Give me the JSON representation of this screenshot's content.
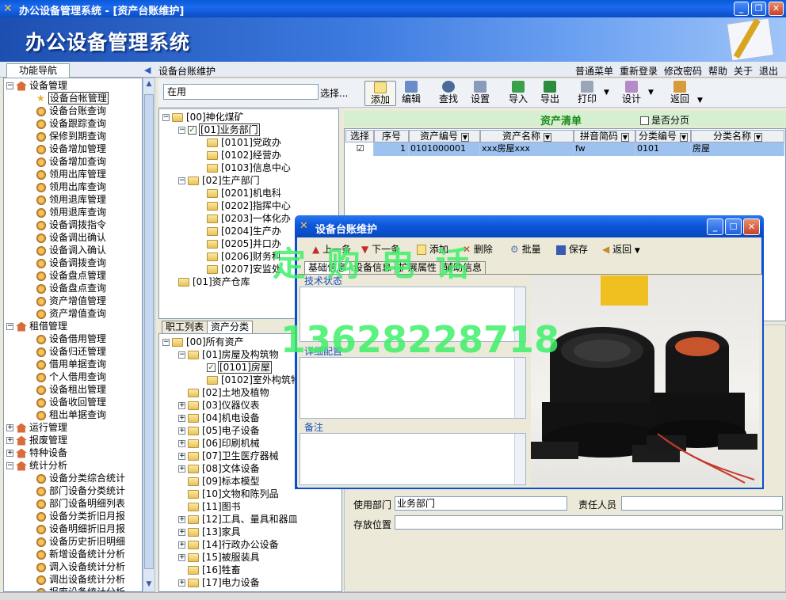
{
  "window": {
    "title": "办公设备管理系统 - [资产台账维护]"
  },
  "banner": {
    "title": "办公设备管理系统"
  },
  "nav": {
    "tab_label": "功能导航",
    "breadcrumb": "设备台账维护",
    "top_menu": [
      "普通菜单",
      "重新登录",
      "修改密码",
      "帮助",
      "关于",
      "退出"
    ]
  },
  "sidebar": {
    "groups": [
      {
        "label": "设备管理",
        "expanded": true,
        "items": [
          "设备台帐管理",
          "设备台账查询",
          "设备跟踪查询",
          "保修到期查询",
          "设备增加管理",
          "设备增加查询",
          "领用出库管理",
          "领用出库查询",
          "领用退库管理",
          "领用退库查询",
          "设备调拨指令",
          "设备调出确认",
          "设备调入确认",
          "设备调拨查询",
          "设备盘点管理",
          "设备盘点查询",
          "资产增值管理",
          "资产增值查询"
        ]
      },
      {
        "label": "租借管理",
        "expanded": true,
        "items": [
          "设备借用管理",
          "设备归还管理",
          "借用单据查询",
          "个人借用查询",
          "设备租出管理",
          "设备收回管理",
          "租出单据查询"
        ]
      },
      {
        "label": "运行管理",
        "expanded": false,
        "items": []
      },
      {
        "label": "报废管理",
        "expanded": false,
        "items": []
      },
      {
        "label": "特种设备",
        "expanded": false,
        "items": []
      },
      {
        "label": "统计分析",
        "expanded": true,
        "items": [
          "设备分类综合统计",
          "部门设备分类统计",
          "部门设备明细列表",
          "设备分类折旧月报",
          "设备明细折旧月报",
          "设备历史折旧明细",
          "新增设备统计分析",
          "调入设备统计分析",
          "调出设备统计分析",
          "报废设备统计分析"
        ]
      }
    ],
    "selected": "设备台帐管理"
  },
  "filter": {
    "status_value": "在用",
    "select_label": "选择..."
  },
  "toolbar": {
    "add": "添加",
    "edit": "编辑",
    "find": "查找",
    "settings": "设置",
    "import": "导入",
    "export": "导出",
    "print": "打印",
    "design": "设计",
    "back": "返回"
  },
  "org_tree": {
    "root": "[00]神化煤矿",
    "nodes": [
      {
        "label": "[01]业务部门",
        "level": 1,
        "checked": true,
        "selected": true
      },
      {
        "label": "[0101]党政办",
        "level": 2
      },
      {
        "label": "[0102]经营办",
        "level": 2
      },
      {
        "label": "[0103]信息中心",
        "level": 2
      },
      {
        "label": "[02]生产部门",
        "level": 1
      },
      {
        "label": "[0201]机电科",
        "level": 2
      },
      {
        "label": "[0202]指挥中心",
        "level": 2
      },
      {
        "label": "[0203]一体化办",
        "level": 2
      },
      {
        "label": "[0204]生产办",
        "level": 2
      },
      {
        "label": "[0205]井口办",
        "level": 2
      },
      {
        "label": "[0206]财务科",
        "level": 2
      },
      {
        "label": "[0207]安监处",
        "level": 2
      },
      {
        "label": "[01]资产仓库",
        "level": 1
      }
    ],
    "tabs": [
      "职工列表",
      "资产分类"
    ]
  },
  "asset_tree": {
    "root": "[00]所有资产",
    "nodes": [
      {
        "label": "[01]房屋及构筑物",
        "level": 1,
        "expanded": true
      },
      {
        "label": "[0101]房屋",
        "level": 2,
        "checked": true,
        "selected": true
      },
      {
        "label": "[0102]室外构筑物",
        "level": 2
      },
      {
        "label": "[02]土地及植物",
        "level": 1
      },
      {
        "label": "[03]仪器仪表",
        "level": 1
      },
      {
        "label": "[04]机电设备",
        "level": 1
      },
      {
        "label": "[05]电子设备",
        "level": 1
      },
      {
        "label": "[06]印刷机械",
        "level": 1
      },
      {
        "label": "[07]卫生医疗器械",
        "level": 1
      },
      {
        "label": "[08]文体设备",
        "level": 1
      },
      {
        "label": "[09]标本模型",
        "level": 1
      },
      {
        "label": "[10]文物和陈列品",
        "level": 1
      },
      {
        "label": "[11]图书",
        "level": 1
      },
      {
        "label": "[12]工具、量具和器皿",
        "level": 1
      },
      {
        "label": "[13]家具",
        "level": 1
      },
      {
        "label": "[14]行政办公设备",
        "level": 1
      },
      {
        "label": "[15]被服装具",
        "level": 1
      },
      {
        "label": "[16]牲畜",
        "level": 1
      },
      {
        "label": "[17]电力设备",
        "level": 1
      }
    ]
  },
  "grid": {
    "title": "资产清单",
    "paginate_label": "是否分页",
    "columns": [
      "选择",
      "序号",
      "资产编号",
      "资产名称",
      "拼音简码",
      "分类编号",
      "分类名称"
    ],
    "rows": [
      {
        "select": "☑",
        "index": "1",
        "asset_no": "0101000001",
        "name": "xxx房屋xxx",
        "pinyin": "fw",
        "class_no": "0101",
        "class_name": "房屋"
      }
    ]
  },
  "dialog": {
    "title": "设备台账维护",
    "tools": [
      "上一条",
      "下一条",
      "添加",
      "删除",
      "批量",
      "保存",
      "返回"
    ],
    "tabs": [
      "基础信息",
      "设备信息",
      "扩展属性",
      "辅助信息"
    ],
    "sections": {
      "tech": "技术状态",
      "detail": "详细配置",
      "note": "备注"
    }
  },
  "form": {
    "dept_label": "使用部门",
    "dept_value": "业务部门",
    "person_label": "责任人员",
    "person_value": "",
    "location_label": "存放位置",
    "location_value": ""
  },
  "watermark": {
    "line1": "定 购 电 话",
    "line2": "13628228718"
  }
}
